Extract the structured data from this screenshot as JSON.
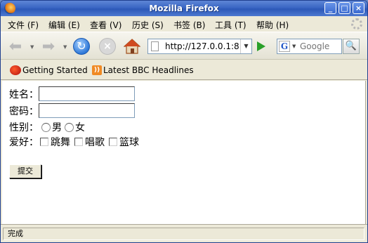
{
  "window": {
    "title": "Mozilla Firefox"
  },
  "menu": [
    {
      "label": "文件 (F)"
    },
    {
      "label": "编辑 (E)"
    },
    {
      "label": "查看 (V)"
    },
    {
      "label": "历史 (S)"
    },
    {
      "label": "书签 (B)"
    },
    {
      "label": "工具 (T)"
    },
    {
      "label": "帮助 (H)"
    }
  ],
  "navigation": {
    "url": "http://127.0.0.1:8",
    "search_placeholder": "Google",
    "search_engine_letter": "G"
  },
  "bookmarks": [
    {
      "label": "Getting Started"
    },
    {
      "label": "Latest BBC Headlines"
    }
  ],
  "form": {
    "name_label": "姓名：",
    "password_label": "密码：",
    "gender_label": "性别：",
    "gender_options": [
      "男",
      "女"
    ],
    "hobby_label": "爱好：",
    "hobby_options": [
      "跳舞",
      "唱歌",
      "篮球"
    ],
    "submit_label": "提交"
  },
  "status": {
    "text": "完成"
  }
}
